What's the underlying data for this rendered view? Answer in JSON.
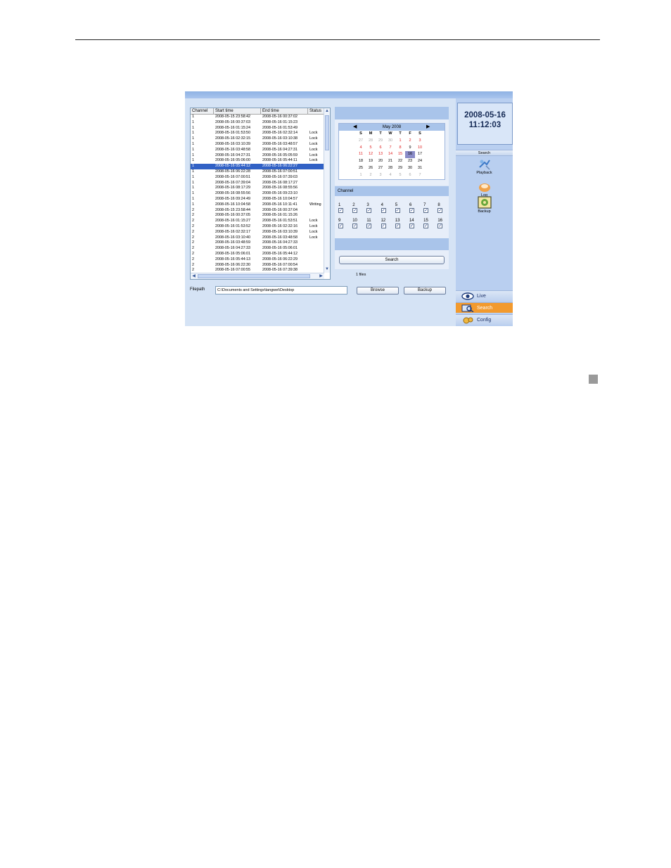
{
  "table": {
    "headers": [
      "Channel",
      "Start time",
      "End time",
      "Status"
    ],
    "rows": [
      [
        "1",
        "2008-05-15 23:58:42",
        "2008-05-16 00:37:02",
        ""
      ],
      [
        "1",
        "2008-05-16 00:37:03",
        "2008-05-16 01:15:23",
        ""
      ],
      [
        "1",
        "2008-05-16 01:15:24",
        "2008-05-16 01:53:49",
        ""
      ],
      [
        "1",
        "2008-05-16 01:53:50",
        "2008-05-16 02:32:14",
        "Lock"
      ],
      [
        "1",
        "2008-05-16 02:32:15",
        "2008-05-16 03:10:38",
        "Lock"
      ],
      [
        "1",
        "2008-05-16 03:10:39",
        "2008-05-16 03:48:57",
        "Lock"
      ],
      [
        "1",
        "2008-05-16 03:48:58",
        "2008-05-16 04:27:31",
        "Lock"
      ],
      [
        "1",
        "2008-05-16 04:27:31",
        "2008-05-16 05:05:59",
        "Lock"
      ],
      [
        "1",
        "2008-05-16 05:06:00",
        "2008-05-16 05:44:11",
        "Lock"
      ],
      [
        "1",
        "2008-05-16 05:44:12",
        "2008-05-16 06:22:27",
        ""
      ],
      [
        "1",
        "2008-05-16 06:22:28",
        "2008-05-16 07:00:51",
        ""
      ],
      [
        "1",
        "2008-05-16 07:00:51",
        "2008-05-16 07:39:03",
        ""
      ],
      [
        "1",
        "2008-05-16 07:39:04",
        "2008-05-16 08:17:27",
        ""
      ],
      [
        "1",
        "2008-05-16 08:17:29",
        "2008-05-16 08:55:56",
        ""
      ],
      [
        "1",
        "2008-05-16 08:55:56",
        "2008-05-16 09:23:10",
        ""
      ],
      [
        "1",
        "2008-05-16 09:24:49",
        "2008-05-16 10:04:57",
        ""
      ],
      [
        "1",
        "2008-05-16 10:04:58",
        "2008-05-16 10:11:41",
        "Writing"
      ],
      [
        "2",
        "2008-05-15 23:58:44",
        "2008-05-16 00:37:04",
        ""
      ],
      [
        "2",
        "2008-05-16 00:37:05",
        "2008-05-16 01:15:26",
        ""
      ],
      [
        "2",
        "2008-05-16 01:15:27",
        "2008-05-16 01:53:51",
        "Lock"
      ],
      [
        "2",
        "2008-05-16 01:53:52",
        "2008-05-16 02:32:16",
        "Lock"
      ],
      [
        "2",
        "2008-05-16 02:32:17",
        "2008-05-16 03:10:39",
        "Lock"
      ],
      [
        "2",
        "2008-05-16 03:10:40",
        "2008-05-16 03:48:58",
        "Lock"
      ],
      [
        "2",
        "2008-05-16 03:48:59",
        "2008-05-16 04:27:33",
        ""
      ],
      [
        "2",
        "2008-05-16 04:27:33",
        "2008-05-16 05:06:01",
        ""
      ],
      [
        "2",
        "2008-05-16 05:06:01",
        "2008-05-16 05:44:12",
        ""
      ],
      [
        "2",
        "2008-05-16 05:44:13",
        "2008-05-16 06:22:29",
        ""
      ],
      [
        "2",
        "2008-05-16 06:22:30",
        "2008-05-16 07:00:54",
        ""
      ],
      [
        "2",
        "2008-05-16 07:00:55",
        "2008-05-16 07:39:38",
        ""
      ]
    ],
    "selected_row": 9
  },
  "calendar": {
    "month_label": "May 2008",
    "weekdays": [
      "S",
      "M",
      "T",
      "W",
      "T",
      "F",
      "S"
    ],
    "days": [
      {
        "d": "27",
        "t": "other"
      },
      {
        "d": "28",
        "t": "other"
      },
      {
        "d": "29",
        "t": "other"
      },
      {
        "d": "30",
        "t": "other"
      },
      {
        "d": "1",
        "t": "red"
      },
      {
        "d": "2",
        "t": "red"
      },
      {
        "d": "3",
        "t": "red"
      },
      {
        "d": "4",
        "t": "red"
      },
      {
        "d": "5",
        "t": "red"
      },
      {
        "d": "6",
        "t": "red"
      },
      {
        "d": "7",
        "t": "red"
      },
      {
        "d": "8",
        "t": "red"
      },
      {
        "d": "9",
        "t": "normal"
      },
      {
        "d": "10",
        "t": "red"
      },
      {
        "d": "11",
        "t": "red"
      },
      {
        "d": "12",
        "t": "red"
      },
      {
        "d": "13",
        "t": "red"
      },
      {
        "d": "14",
        "t": "red"
      },
      {
        "d": "15",
        "t": "red"
      },
      {
        "d": "16",
        "t": "today"
      },
      {
        "d": "17",
        "t": "normal"
      },
      {
        "d": "18",
        "t": "normal"
      },
      {
        "d": "19",
        "t": "normal"
      },
      {
        "d": "20",
        "t": "normal"
      },
      {
        "d": "21",
        "t": "normal"
      },
      {
        "d": "22",
        "t": "normal"
      },
      {
        "d": "23",
        "t": "normal"
      },
      {
        "d": "24",
        "t": "normal"
      },
      {
        "d": "25",
        "t": "normal"
      },
      {
        "d": "26",
        "t": "normal"
      },
      {
        "d": "27",
        "t": "normal"
      },
      {
        "d": "28",
        "t": "normal"
      },
      {
        "d": "29",
        "t": "normal"
      },
      {
        "d": "30",
        "t": "normal"
      },
      {
        "d": "31",
        "t": "normal"
      },
      {
        "d": "1",
        "t": "other"
      },
      {
        "d": "2",
        "t": "other"
      },
      {
        "d": "3",
        "t": "other"
      },
      {
        "d": "4",
        "t": "other"
      },
      {
        "d": "5",
        "t": "other"
      },
      {
        "d": "6",
        "t": "other"
      },
      {
        "d": "7",
        "t": "other"
      }
    ]
  },
  "channel": {
    "label": "Channel",
    "channels": [
      "1",
      "2",
      "3",
      "4",
      "5",
      "6",
      "7",
      "8",
      "9",
      "10",
      "11",
      "12",
      "13",
      "14",
      "15",
      "16"
    ],
    "all_checked": true
  },
  "search": {
    "button_label": "Search",
    "result": "1 files"
  },
  "filepath": {
    "label": "Filepath",
    "value": "C:\\Documents and Settings\\tangwei\\Desktop",
    "browse_label": "Browse",
    "backup_label": "Backup"
  },
  "sidebar": {
    "date": "2008-05-16",
    "time": "11:12:03",
    "section_tab": "Search",
    "items": [
      "Playback",
      "Log",
      "Backup"
    ],
    "nav": [
      "Live",
      "Search",
      "Config"
    ],
    "active_nav": "Search"
  },
  "colors": {
    "selection": "#3161c5",
    "accent": "#f29a2e",
    "panel": "#a9c4ea",
    "marked_day": "#e02020"
  }
}
